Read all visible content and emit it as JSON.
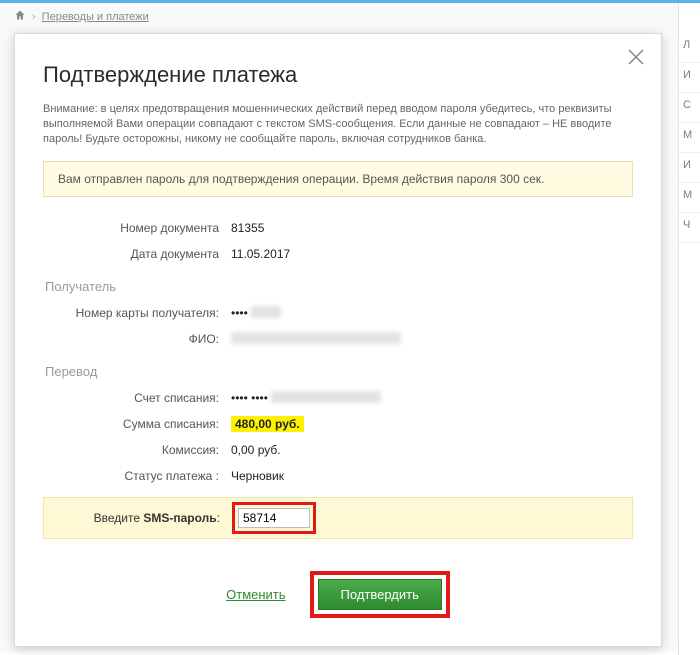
{
  "breadcrumb": {
    "label": "Переводы и платежи"
  },
  "sidebar": {
    "items": [
      "Л",
      "И",
      "С",
      "М",
      "И",
      "М",
      "Ч"
    ]
  },
  "modal": {
    "title": "Подтверждение платежа",
    "warning": "Внимание: в целях предотвращения мошеннических действий перед вводом пароля убедитесь, что реквизиты выполняемой Вами операции совпадают с текстом SMS-сообщения. Если данные не совпадают – НЕ вводите пароль! Будьте осторожны, никому не сообщайте пароль, включая сотрудников банка.",
    "alert": "Вам отправлен пароль для подтверждения операции. Время действия пароля 300 сек.",
    "fields": {
      "doc_number": {
        "label": "Номер документа",
        "value": "81355"
      },
      "doc_date": {
        "label": "Дата документа",
        "value": "11.05.2017"
      }
    },
    "sections": {
      "recipient": {
        "title": "Получатель",
        "card": {
          "label": "Номер карты получателя:",
          "masked_prefix": "•••• "
        },
        "fio": {
          "label": "ФИО:"
        }
      },
      "transfer": {
        "title": "Перевод",
        "account": {
          "label": "Счет списания:",
          "masked_prefix": "•••• •••• "
        },
        "amount": {
          "label": "Сумма списания:",
          "value": "480,00  руб."
        },
        "fee": {
          "label": "Комиссия:",
          "value": "0,00 руб."
        },
        "status": {
          "label": "Статус платежа :",
          "value": "Черновик"
        }
      }
    },
    "sms": {
      "label_prefix": "Введите ",
      "label_bold": "SMS-пароль",
      "label_suffix": ":",
      "value": "58714"
    },
    "actions": {
      "cancel": "Отменить",
      "confirm": "Подтвердить"
    }
  }
}
